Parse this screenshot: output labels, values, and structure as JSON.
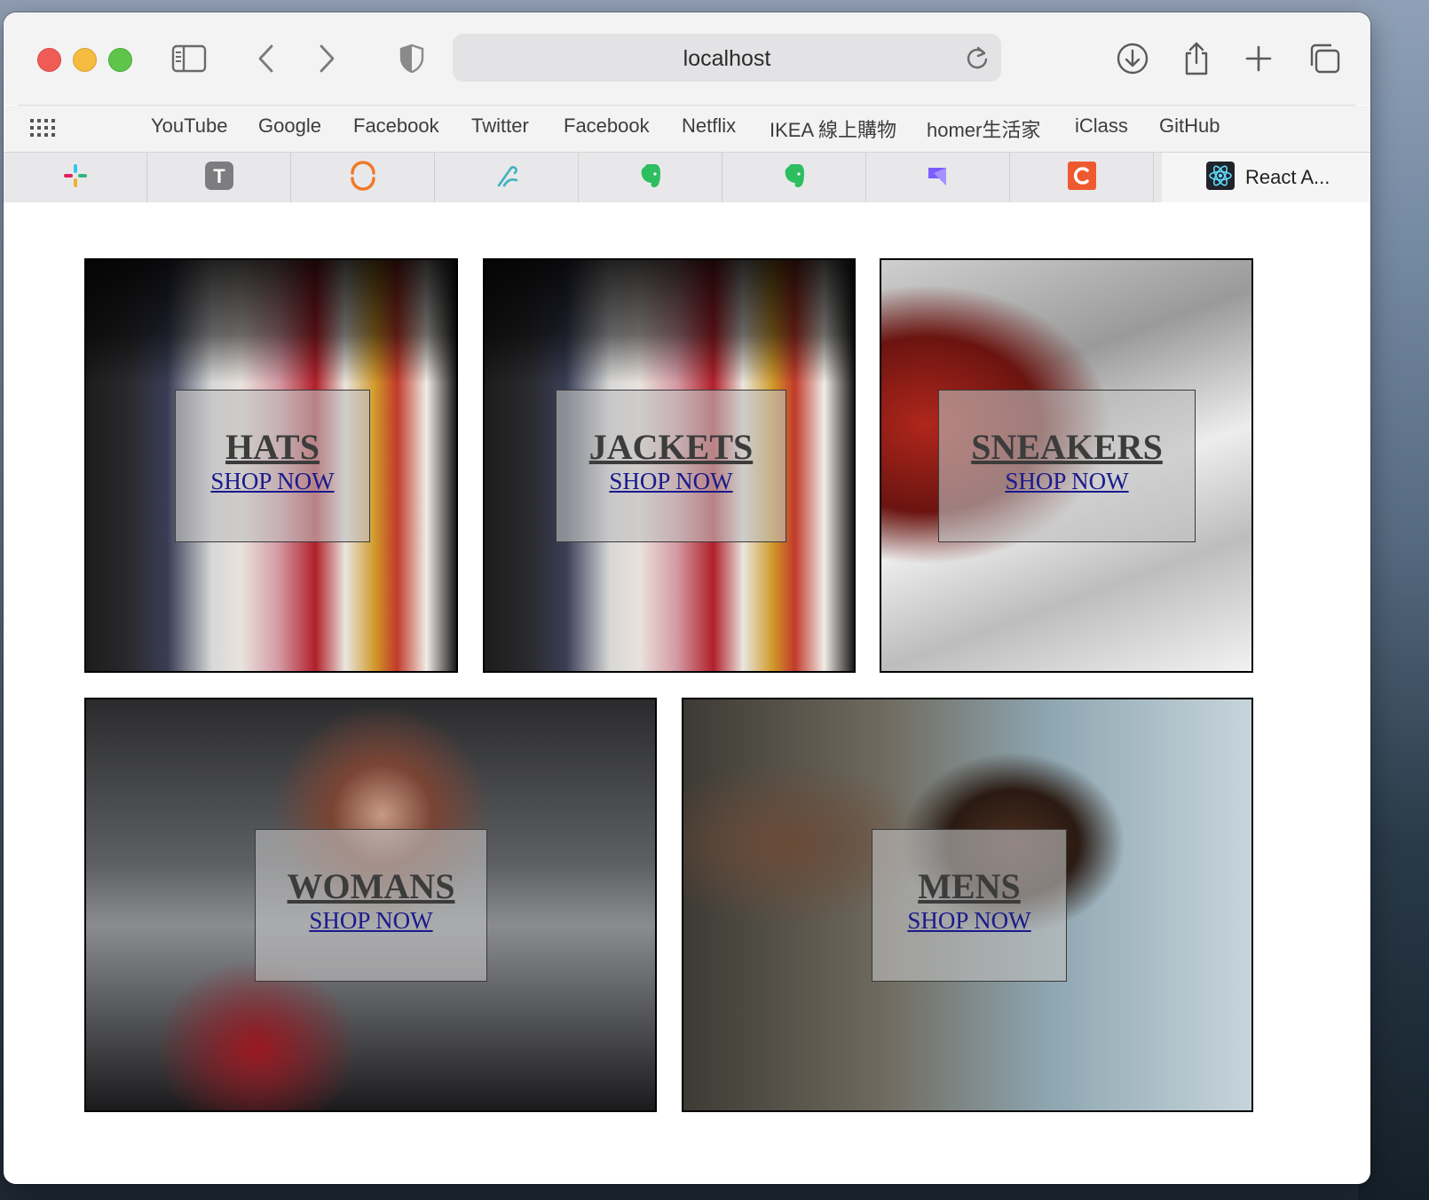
{
  "browser": {
    "url": "localhost",
    "icons": {
      "sidebar": "sidebar-icon",
      "back": "chevron-left-icon",
      "forward": "chevron-right-icon",
      "privacy": "shield-icon",
      "reload": "reload-icon",
      "download": "download-icon",
      "share": "share-icon",
      "new_tab": "plus-icon",
      "tab_overview": "tabs-icon"
    }
  },
  "favorites": [
    "YouTube",
    "Google",
    "Facebook",
    "Twitter",
    "Facebook",
    "Netflix",
    "IKEA 線上購物",
    "homer生活家",
    "iClass",
    "GitHub"
  ],
  "tabs": [
    {
      "icon": "slack-icon"
    },
    {
      "icon": "typora-t-icon"
    },
    {
      "icon": "orange-ring-icon"
    },
    {
      "icon": "tool-icon"
    },
    {
      "icon": "evernote-icon"
    },
    {
      "icon": "evernote-icon"
    },
    {
      "icon": "linear-icon"
    },
    {
      "icon": "c-letter-icon"
    }
  ],
  "active_tab": {
    "label": "React A...",
    "icon": "react-icon"
  },
  "tiles": [
    {
      "title": "HATS",
      "cta": "SHOP NOW"
    },
    {
      "title": "JACKETS",
      "cta": "SHOP NOW"
    },
    {
      "title": "SNEAKERS",
      "cta": "SHOP NOW"
    },
    {
      "title": "WOMANS",
      "cta": "SHOP NOW"
    },
    {
      "title": "MENS",
      "cta": "SHOP NOW"
    }
  ],
  "colors": {
    "link": "#1a1a8c",
    "traffic_red": "#ee5c55",
    "traffic_yellow": "#f5bc40",
    "traffic_green": "#5fc54a"
  }
}
